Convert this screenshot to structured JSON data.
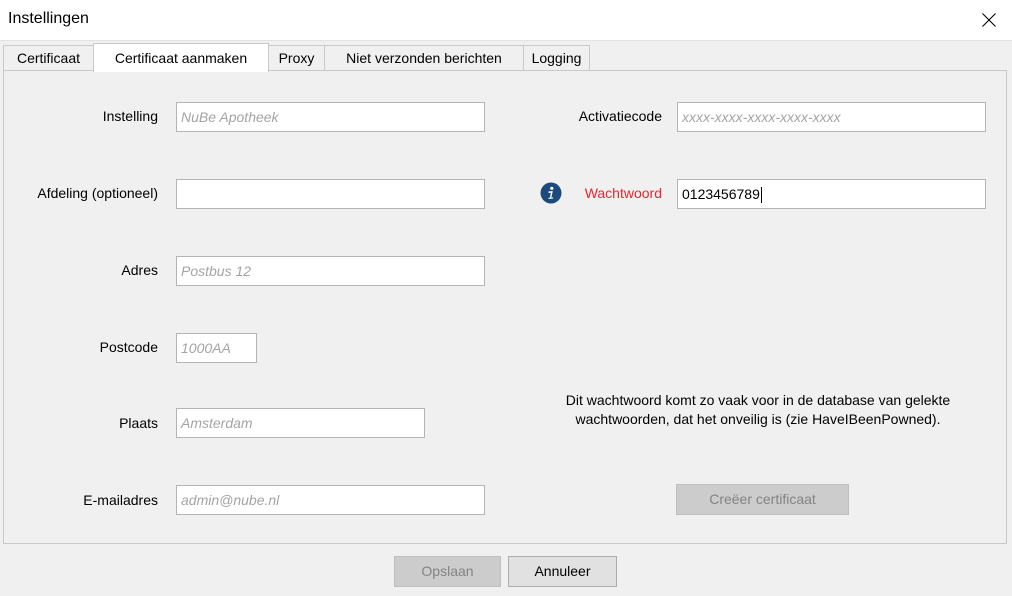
{
  "window": {
    "title": "Instellingen",
    "close_icon": "close-icon"
  },
  "tabs": [
    {
      "label": "Certificaat"
    },
    {
      "label": "Certificaat aanmaken"
    },
    {
      "label": "Proxy"
    },
    {
      "label": "Niet verzonden berichten"
    },
    {
      "label": "Logging"
    }
  ],
  "form": {
    "instelling": {
      "label": "Instelling",
      "value": "",
      "placeholder": "NuBe Apotheek"
    },
    "afdeling": {
      "label": "Afdeling (optioneel)",
      "value": "",
      "placeholder": ""
    },
    "adres": {
      "label": "Adres",
      "value": "",
      "placeholder": "Postbus 12"
    },
    "postcode": {
      "label": "Postcode",
      "value": "",
      "placeholder": "1000AA"
    },
    "plaats": {
      "label": "Plaats",
      "value": "",
      "placeholder": "Amsterdam"
    },
    "email": {
      "label": "E-mailadres",
      "value": "",
      "placeholder": "admin@nube.nl"
    },
    "activatiecode": {
      "label": "Activatiecode",
      "value": "",
      "placeholder": "xxxx-xxxx-xxxx-xxxx-xxxx"
    },
    "wachtwoord": {
      "label": "Wachtwoord",
      "value": "0123456789",
      "label_color": "#e8262c"
    }
  },
  "warning": {
    "line1": "Dit wachtwoord komt zo vaak voor in de database van gelekte",
    "line2": "wachtwoorden, dat het onveilig is (zie HaveIBeenPowned)."
  },
  "buttons": {
    "create_certificate": "Creëer certificaat",
    "save": "Opslaan",
    "cancel": "Annuleer"
  },
  "colors": {
    "error": "#e8262c",
    "info_icon": "#1c4a7a"
  }
}
